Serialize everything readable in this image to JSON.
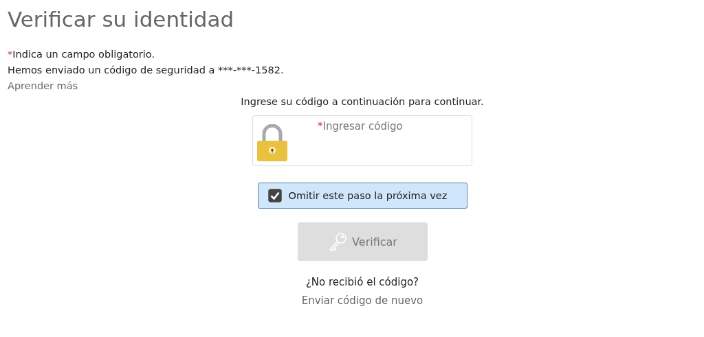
{
  "title": "Verificar su identidad",
  "required_note": {
    "mark": "*",
    "text": "Indica un campo obligatorio."
  },
  "sent_message": "Hemos enviado un código de seguridad a ***-***-1582.",
  "learn_more": "Aprender más",
  "instruction": "Ingrese su código a continuación para continuar.",
  "code_field": {
    "required_mark": "*",
    "placeholder": "Ingresar código"
  },
  "skip_option": {
    "label": "Omitir este paso la próxima vez",
    "checked": true
  },
  "verify_button": {
    "label": "Verificar",
    "disabled": true
  },
  "not_received": "¿No recibió el código?",
  "resend_link": "Enviar código de nuevo"
}
